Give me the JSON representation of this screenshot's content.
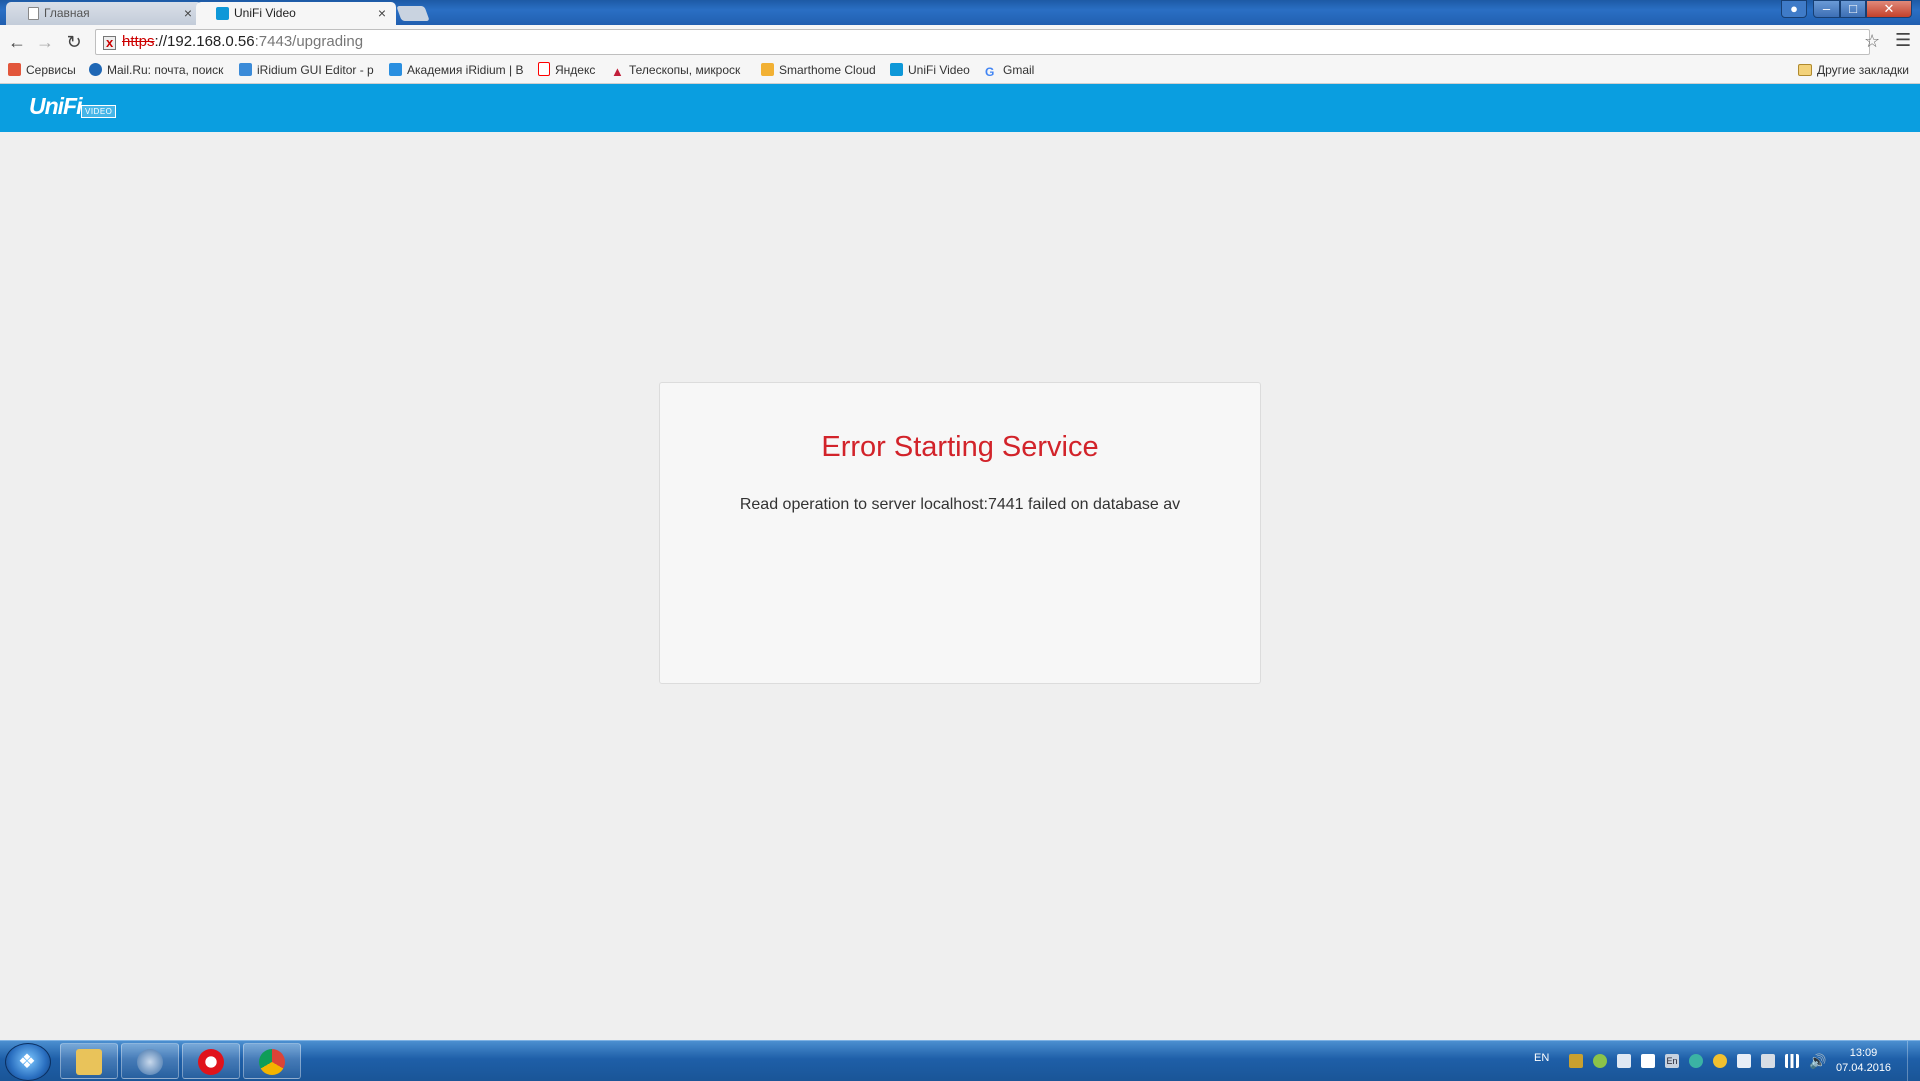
{
  "browser": {
    "tabs": [
      {
        "label": "Главная",
        "active": false
      },
      {
        "label": "UniFi Video",
        "active": true
      }
    ],
    "close_glyph": "×",
    "address": {
      "scheme": "https",
      "host": "://192.168.0.56",
      "rest": ":7443/upgrading"
    },
    "bookmarks": [
      {
        "label": "Сервисы",
        "icon": "apps-grid-icon",
        "color": "#e2563b"
      },
      {
        "label": "Mail.Ru: почта, поиск",
        "icon": "mailru-icon",
        "color": "#1f67b5"
      },
      {
        "label": "iRidium GUI Editor - p",
        "icon": "iridium-icon",
        "color": "#3b8bd8"
      },
      {
        "label": "Академия iRidium | В",
        "icon": "iridium-academy-icon",
        "color": "#2a8fe0"
      },
      {
        "label": "Яндекс",
        "icon": "yandex-icon",
        "color": "#ff0000"
      },
      {
        "label": "Телескопы, микроск",
        "icon": "telescope-site-icon",
        "color": "#c21f3a"
      },
      {
        "label": "Smarthome Cloud",
        "icon": "smarthome-cloud-icon",
        "color": "#f2b134"
      },
      {
        "label": "UniFi Video",
        "icon": "unifi-icon",
        "color": "#0e98d8"
      },
      {
        "label": "Gmail",
        "icon": "google-icon",
        "color": "#4285f4"
      }
    ],
    "other_bookmarks": "Другие закладки"
  },
  "app": {
    "logo_text": "UniFi",
    "logo_sub": "VIDEO",
    "accent": "#0a9ee0"
  },
  "error": {
    "title": "Error Starting Service",
    "message": "Read operation to server localhost:7441 failed on database av",
    "title_color": "#d2232a"
  },
  "taskbar": {
    "language": "EN",
    "time": "13:09",
    "date": "07.04.2016",
    "tray_en": "En"
  }
}
